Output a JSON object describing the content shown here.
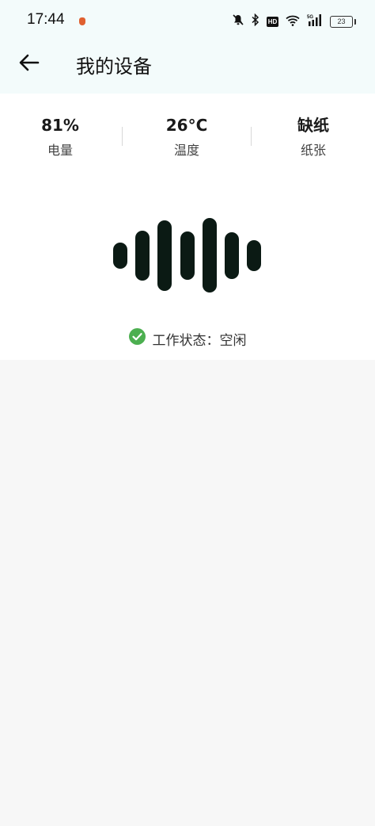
{
  "statusbar": {
    "time": "17:44",
    "battery_level": "23",
    "icons": [
      "mute-bell-icon",
      "bluetooth-icon",
      "hd-icon",
      "wifi-icon",
      "signal-5g-icon",
      "battery-icon"
    ],
    "hd_label": "HD"
  },
  "header": {
    "title": "我的设备",
    "back_icon": "arrow-left-icon"
  },
  "stats": [
    {
      "value": "81%",
      "label": "电量"
    },
    {
      "value": "26°C",
      "label": "温度"
    },
    {
      "value": "缺纸",
      "label": "纸张"
    }
  ],
  "device": {
    "wave_icon": "sound-wave-icon",
    "status_icon": "check-circle-icon",
    "status_text": "工作状态：空闲",
    "status_color": "#4caf50",
    "wave_color": "#0b1a14"
  },
  "colors": {
    "header_bg": "#f3fbfb",
    "page_bg": "#f7f7f7"
  }
}
